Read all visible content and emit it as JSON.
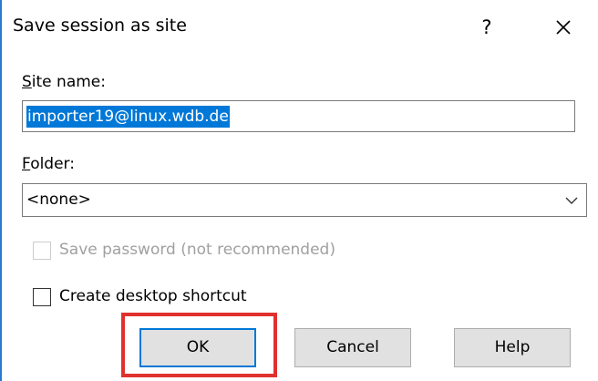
{
  "dialog": {
    "title": "Save session as site",
    "help_glyph": "?",
    "close_icon": "close-icon"
  },
  "site_name": {
    "label_accel": "S",
    "label_rest": "ite name:",
    "value": "importer19@linux.wdb.de"
  },
  "folder": {
    "label_accel": "F",
    "label_rest": "older:",
    "selected": "<none>"
  },
  "save_password": {
    "label": "Save password (not recommended)",
    "checked": false,
    "disabled": true
  },
  "desktop_shortcut": {
    "label": "Create desktop shortcut",
    "checked": false
  },
  "buttons": {
    "ok": "OK",
    "cancel": "Cancel",
    "help": "Help"
  },
  "colors": {
    "accent": "#0078d7",
    "highlight": "#e0312f"
  }
}
